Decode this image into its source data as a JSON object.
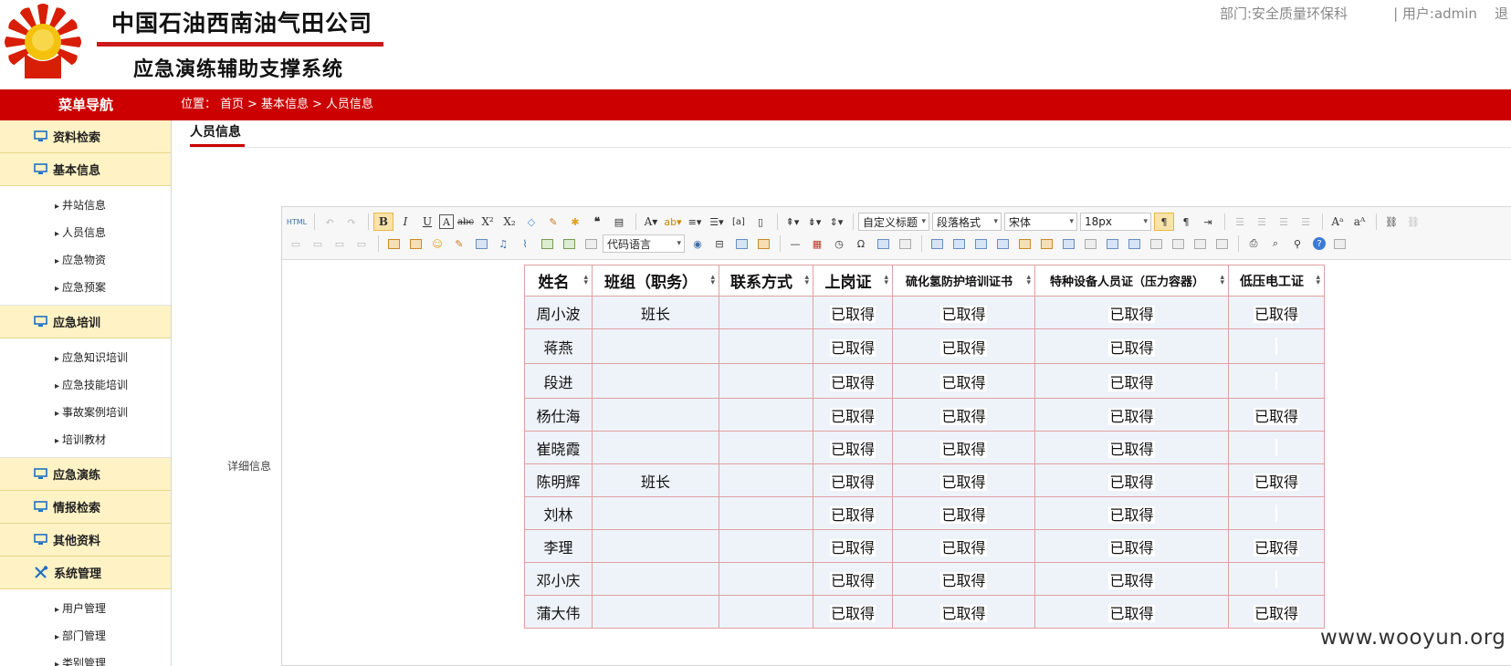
{
  "header": {
    "company": "中国石油西南油气田公司",
    "system": "应急演练辅助支撑系统",
    "department": "部门:安全质量环保科",
    "user": "| 用户:admin",
    "logout_fragment": "退"
  },
  "nav": {
    "menu_title": "菜单导航",
    "breadcrumb": [
      "位置：",
      "首页",
      ">",
      "基本信息",
      ">",
      "人员信息"
    ]
  },
  "sidebar": {
    "sections": [
      {
        "label": "资料检索",
        "icon": "monitor-icon",
        "items": []
      },
      {
        "label": "基本信息",
        "icon": "monitor-icon",
        "items": [
          "井站信息",
          "人员信息",
          "应急物资",
          "应急预案"
        ]
      },
      {
        "label": "应急培训",
        "icon": "monitor-icon",
        "items": [
          "应急知识培训",
          "应急技能培训",
          "事故案例培训",
          "培训教材"
        ]
      },
      {
        "label": "应急演练",
        "icon": "monitor-icon",
        "items": []
      },
      {
        "label": "情报检索",
        "icon": "monitor-icon",
        "items": []
      },
      {
        "label": "其他资料",
        "icon": "monitor-icon",
        "items": []
      },
      {
        "label": "系统管理",
        "icon": "tools-icon",
        "items": [
          "用户管理",
          "部门管理",
          "类别管理"
        ]
      }
    ]
  },
  "content": {
    "tab_label": "人员信息",
    "detail_label": "详细信息"
  },
  "editor": {
    "heading_select": "自定义标题",
    "paragraph_select": "段落格式",
    "font_select": "宋体",
    "size_select": "18px",
    "code_select": "代码语言",
    "html_label": "HTML"
  },
  "table": {
    "headers": [
      "姓名",
      "班组（职务）",
      "联系方式",
      "上岗证",
      "硫化氢防护培训证书",
      "特种设备人员证（压力容器）",
      "低压电工证"
    ],
    "rows": [
      [
        "周小波",
        "班长",
        "",
        "已取得",
        "已取得",
        "已取得",
        "已取得"
      ],
      [
        "蒋燕",
        "",
        "",
        "已取得",
        "已取得",
        "已取得",
        ""
      ],
      [
        "段进",
        "",
        "",
        "已取得",
        "已取得",
        "已取得",
        ""
      ],
      [
        "杨仕海",
        "",
        "",
        "已取得",
        "已取得",
        "已取得",
        "已取得"
      ],
      [
        "崔晓霞",
        "",
        "",
        "已取得",
        "已取得",
        "已取得",
        ""
      ],
      [
        "陈明辉",
        "班长",
        "",
        "已取得",
        "已取得",
        "已取得",
        "已取得"
      ],
      [
        "刘林",
        "",
        "",
        "已取得",
        "已取得",
        "已取得",
        ""
      ],
      [
        "李理",
        "",
        "",
        "已取得",
        "已取得",
        "已取得",
        "已取得"
      ],
      [
        "邓小庆",
        "",
        "",
        "已取得",
        "已取得",
        "已取得",
        ""
      ],
      [
        "蒲大伟",
        "",
        "",
        "已取得",
        "已取得",
        "已取得",
        "已取得"
      ]
    ]
  },
  "watermark": "www.wooyun.org",
  "colors": {
    "brand_red": "#cc0000",
    "sidebar_section": "#fff3c6",
    "table_border": "#e0a0a0",
    "cell_bg": "#eef3f9"
  }
}
